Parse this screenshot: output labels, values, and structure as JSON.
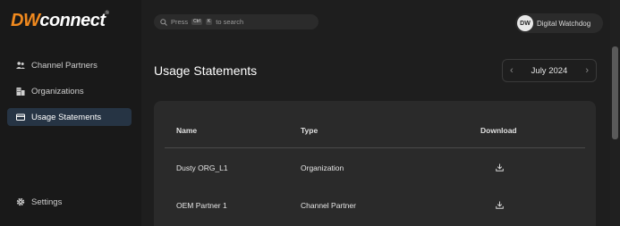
{
  "brand": {
    "logo_part1": "DW",
    "logo_part2": "connect",
    "trademark": "®"
  },
  "sidebar": {
    "items": [
      {
        "label": "Channel Partners",
        "icon": "partners-icon",
        "active": false
      },
      {
        "label": "Organizations",
        "icon": "organizations-icon",
        "active": false
      },
      {
        "label": "Usage Statements",
        "icon": "statement-card-icon",
        "active": true
      }
    ],
    "settings_label": "Settings"
  },
  "search": {
    "text_before": "Press",
    "key1": "Ctrl",
    "key2": "K",
    "text_after": "to search"
  },
  "user": {
    "initials": "DW",
    "name": "Digital Watchdog"
  },
  "page": {
    "title": "Usage Statements"
  },
  "month_picker": {
    "value": "July 2024"
  },
  "table": {
    "columns": [
      "Name",
      "Type",
      "Download"
    ],
    "rows": [
      {
        "name": "Dusty ORG_L1",
        "type": "Organization"
      },
      {
        "name": "OEM Partner 1",
        "type": "Channel Partner"
      }
    ]
  },
  "colors": {
    "accent": "#f28a1e",
    "active_nav": "#263444",
    "background": "#1e1e1e"
  }
}
